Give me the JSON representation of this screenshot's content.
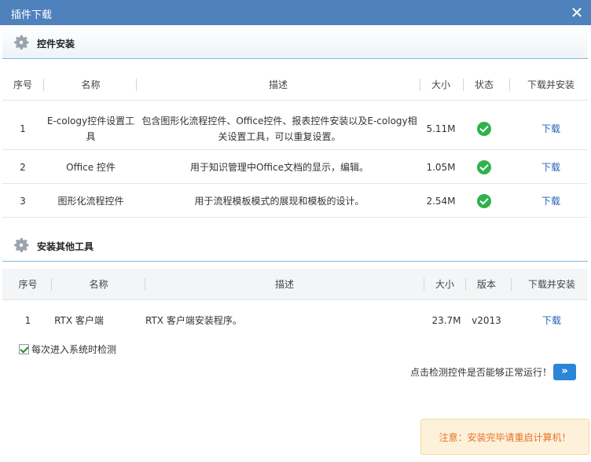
{
  "window": {
    "title": "插件下载",
    "close_icon": "close-icon"
  },
  "section1": {
    "title": "控件安装",
    "icon": "gear-icon",
    "headers": [
      "序号",
      "名称",
      "描述",
      "大小",
      "状态",
      "下载并安装"
    ],
    "rows": [
      {
        "no": "1",
        "name": "E-cology控件设置工具",
        "desc": "包含图形化流程控件、Office控件、报表控件安装以及E-cology相关设置工具，可以重复设置。",
        "size": "5.11M",
        "status": "ok",
        "action": "下载"
      },
      {
        "no": "2",
        "name": "Office 控件",
        "desc": "用于知识管理中Office文档的显示，编辑。",
        "size": "1.05M",
        "status": "ok",
        "action": "下载"
      },
      {
        "no": "3",
        "name": "图形化流程控件",
        "desc": "用于流程模板模式的展现和模板的设计。",
        "size": "2.54M",
        "status": "ok",
        "action": "下载"
      }
    ]
  },
  "section2": {
    "title": "安装其他工具",
    "icon": "gear-icon",
    "headers": [
      "序号",
      "名称",
      "描述",
      "大小",
      "版本",
      "下载并安装"
    ],
    "rows": [
      {
        "no": "1",
        "name": "RTX 客户端",
        "desc": "RTX 客户端安装程序。",
        "size": "23.7M",
        "version": "v2013",
        "action": "下载"
      }
    ]
  },
  "checkbox": {
    "label": "每次进入系统时检测",
    "checked": true
  },
  "detect": {
    "text": "点击检测控件是否能够正常运行！",
    "button": "»"
  },
  "notice": {
    "text": "注意：安装完毕请重启计算机！"
  },
  "colors": {
    "titlebar": "#4f81bd",
    "ok": "#2eb34a",
    "link": "#2366b3",
    "notice_text": "#e8732b"
  }
}
